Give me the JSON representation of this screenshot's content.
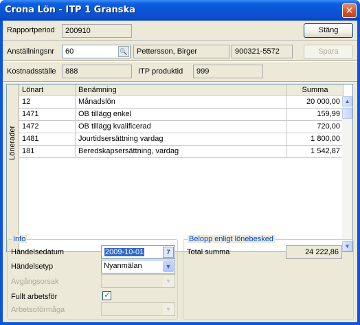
{
  "window": {
    "title": "Crona Lön - ITP 1 Granska",
    "close": "✕"
  },
  "header": {
    "rapportperiod_label": "Rapportperiod",
    "rapportperiod_value": "200910",
    "stang_button": "Stäng",
    "anstallningsnr_label": "Anställningsnr",
    "anstallningsnr_value": "60",
    "employee_name": "Pettersson, Birger",
    "personnummer": "900321-5572",
    "spara_button": "Spara",
    "kostnadsstalle_label": "Kostnadsställe",
    "kostnadsstalle_value": "888",
    "itp_produktid_label": "ITP produktid",
    "itp_produktid_value": "999"
  },
  "grid": {
    "side_tab": "Lönerader",
    "columns": [
      "Lönart",
      "Benämning",
      "Summa"
    ],
    "rows": [
      [
        "12",
        "Månadslön",
        "20 000,00"
      ],
      [
        "1471",
        "OB tillägg enkel",
        "159,99"
      ],
      [
        "1472",
        "OB tillägg kvalificerad",
        "720,00"
      ],
      [
        "1481",
        "Jourtidsersättning vardag",
        "1 800,00"
      ],
      [
        "181",
        "Beredskapsersättning, vardag",
        "1 542,87"
      ]
    ]
  },
  "info": {
    "title": "Info",
    "handelsedatum_label": "Händelsedatum",
    "handelsedatum_value": "2009-10-01",
    "handelsetyp_label": "Händelsetyp",
    "handelsetyp_value": "Nyanmälan",
    "avgangsorsak_label": "Avgångsorsak",
    "fullt_arbetsfor_label": "Fullt arbetsför",
    "arbetsformaga_label": "Arbetsoförmåga"
  },
  "belopp": {
    "title": "Belopp enligt lönebesked",
    "total_label": "Total summa",
    "total_value": "24 222,86"
  },
  "colors": {
    "titlebar": "#0a55d8",
    "group_title": "#0046d5",
    "face": "#ece9d8"
  }
}
